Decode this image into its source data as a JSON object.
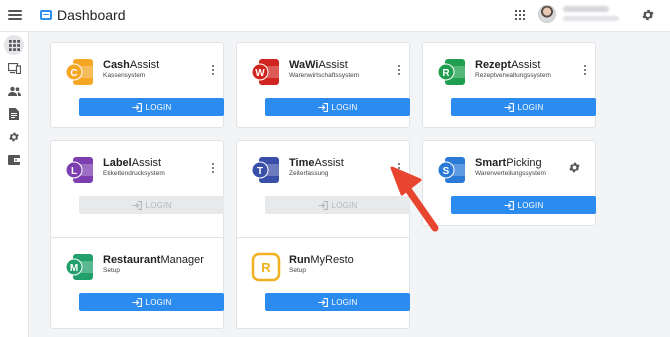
{
  "header": {
    "title": "Dashboard",
    "apps_icon": "apps-grid-icon",
    "settings_icon": "gear-icon",
    "menu_icon": "hamburger-icon"
  },
  "sidebar": {
    "items": [
      {
        "icon": "apps-grid-icon",
        "active": true
      },
      {
        "icon": "monitor-icon",
        "active": false
      },
      {
        "icon": "people-icon",
        "active": false
      },
      {
        "icon": "document-icon",
        "active": false
      },
      {
        "icon": "gear-icon",
        "active": false
      },
      {
        "icon": "wallet-icon",
        "active": false
      }
    ]
  },
  "apps": [
    {
      "bold": "Cash",
      "rest": "Assist",
      "subtitle": "Kassensystem",
      "letter": "C",
      "color": "#f5a623",
      "button": "LOGIN",
      "enabled": true,
      "action": "menu"
    },
    {
      "bold": "WaWi",
      "rest": "Assist",
      "subtitle": "Warenwirtschaftssystem",
      "letter": "W",
      "color": "#d0251e",
      "button": "LOGIN",
      "enabled": true,
      "action": "menu"
    },
    {
      "bold": "Rezept",
      "rest": "Assist",
      "subtitle": "Rezeptverwaltungssystem",
      "letter": "R",
      "color": "#1e9e4e",
      "button": "LOGIN",
      "enabled": true,
      "action": "menu"
    },
    {
      "bold": "Label",
      "rest": "Assist",
      "subtitle": "Etikettendrucksystem",
      "letter": "L",
      "color": "#7b3fb0",
      "button": "LOGIN",
      "enabled": false,
      "action": "menu"
    },
    {
      "bold": "Time",
      "rest": "Assist",
      "subtitle": "Zeiterfassung",
      "letter": "T",
      "color": "#3a4fa8",
      "button": "LOGIN",
      "enabled": false,
      "action": "menu"
    },
    {
      "bold": "Smart",
      "rest": "Picking",
      "subtitle": "Warenverteilungssystem",
      "letter": "S",
      "color": "#2a7ad6",
      "button": "LOGIN",
      "enabled": true,
      "action": "settings"
    },
    {
      "bold": "Restaurant",
      "rest": "Manager",
      "subtitle": "Setup",
      "letter": "M",
      "color": "#22a06b",
      "button": "LOGIN",
      "enabled": true,
      "action": "none"
    },
    {
      "bold": "Run",
      "rest": "MyResto",
      "subtitle": "Setup",
      "letter": "R",
      "color": "#f2b01e",
      "button": "LOGIN",
      "enabled": true,
      "action": "none",
      "outline": true
    }
  ]
}
